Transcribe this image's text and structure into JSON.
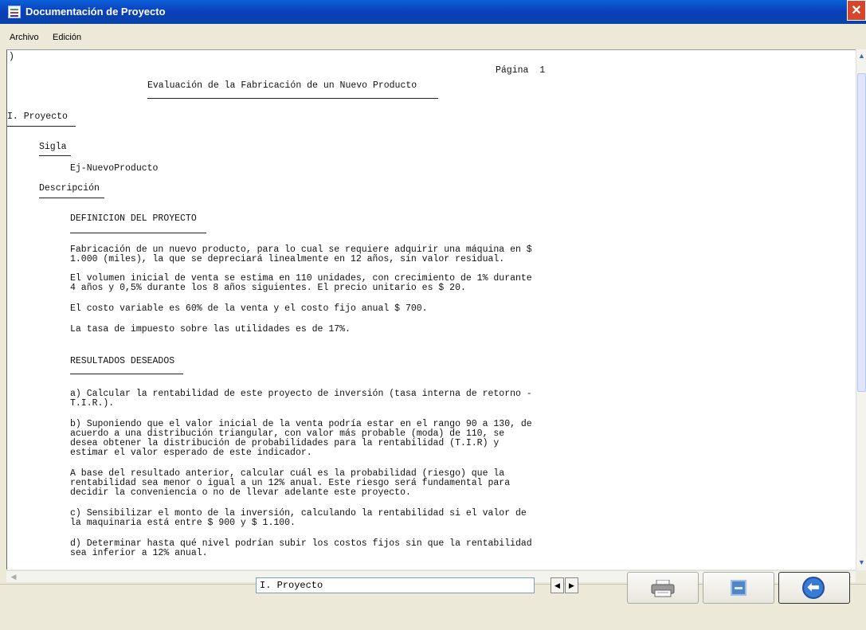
{
  "window": {
    "title": "Documentación de Proyecto",
    "close_glyph": "✕"
  },
  "menu": {
    "archivo": "Archivo",
    "edicion": "Edición"
  },
  "document": {
    "corner_mark": ")",
    "page_label": "Página  1",
    "title": "Evaluación de la Fabricación de un Nuevo Producto",
    "section": "I. Proyecto",
    "sigla_label": "Sigla",
    "sigla_value": "Ej-NuevoProducto",
    "descripcion_label": "Descripción",
    "definicion_heading": "DEFINICION DEL PROYECTO",
    "p1_l1": "Fabricación de un nuevo producto, para lo cual se requiere adquirir una máquina en $",
    "p1_l2": "1.000 (miles), la que se depreciará linealmente en 12 años, sin valor residual.",
    "p2_l1": "El volumen inicial de venta se estima en 110 unidades, con crecimiento de 1% durante",
    "p2_l2": "4 años y 0,5% durante los 8 años siguientes. El precio unitario es $ 20.",
    "p3": "El costo variable es 60% de la venta y el costo fijo anual $ 700.",
    "p4": "La tasa de impuesto sobre las utilidades es de 17%.",
    "resultados_heading": "RESULTADOS DESEADOS",
    "a_l1": "a) Calcular la rentabilidad de este proyecto de inversión (tasa interna de retorno -",
    "a_l2": "T.I.R.).",
    "b_l1": "b) Suponiendo que el valor inicial de la venta podría estar en el rango 90 a 130, de",
    "b_l2": "acuerdo a una distribución triangular, con valor más probable (moda) de 110, se",
    "b_l3": "desea obtener la distribución de probabilidades para la rentabilidad (T.I.R) y",
    "b_l4": "estimar el valor esperado de este indicador.",
    "base_l1": "A base del resultado anterior, calcular cuál es la probabilidad (riesgo) que la",
    "base_l2": "rentabilidad sea menor o igual a un 12% anual. Este riesgo será fundamental para",
    "base_l3": "decidir la conveniencia o no de llevar adelante este proyecto.",
    "c_l1": "c) Sensibilizar el monto de la inversión, calculando la rentabilidad si el valor de",
    "c_l2": "la maquinaria está entre $ 900 y $ 1.100.",
    "d_l1": "d) Determinar hasta qué nivel podrían subir los costos fijos sin que la rentabilidad",
    "d_l2": "sea inferior a 12% anual."
  },
  "bottom": {
    "section_field": "I. Proyecto",
    "prev_glyph": "◀",
    "next_glyph": "▶",
    "icons": {
      "print": "printer-icon",
      "save": "save-icon",
      "back": "back-arrow-icon"
    }
  },
  "scroll": {
    "up": "▲",
    "down": "▼",
    "left": "◀",
    "right": "▶"
  }
}
